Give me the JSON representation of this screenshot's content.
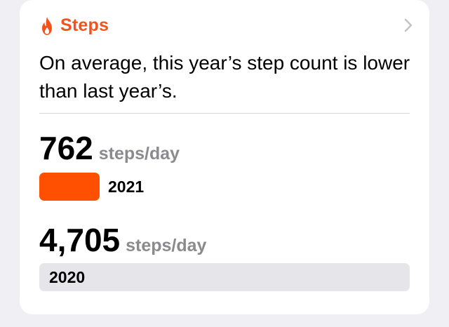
{
  "card": {
    "title": "Steps",
    "title_color": "#f2531d",
    "icon": "flame-icon",
    "nav_icon": "chevron-right-icon",
    "summary": "On average, this year’s step count is lower than last year’s."
  },
  "comparison": [
    {
      "value": "762",
      "unit": "steps/day",
      "year": "2021",
      "bar_color": "#ff4f00",
      "steps": 762
    },
    {
      "value": "4,705",
      "unit": "steps/day",
      "year": "2020",
      "bar_color": "#e6e6ea",
      "steps": 4705
    }
  ]
}
